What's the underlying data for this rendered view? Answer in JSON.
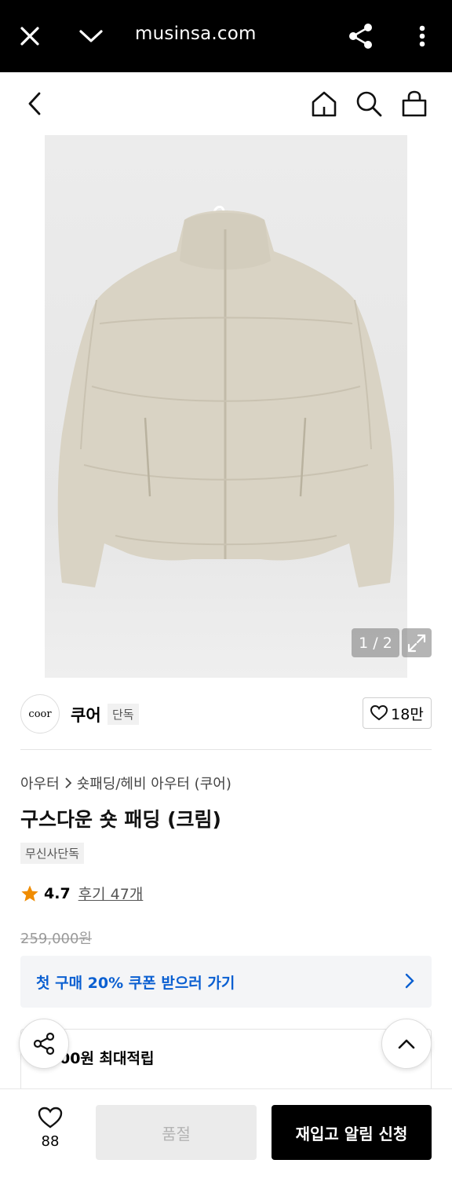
{
  "browser": {
    "url": "musinsa.com",
    "icons": [
      "close-icon",
      "chevron-down-icon",
      "share-icon",
      "more-vertical-icon"
    ]
  },
  "header": {
    "icons": [
      "back-icon",
      "home-icon",
      "search-icon",
      "bag-icon"
    ]
  },
  "gallery": {
    "counter": "1 / 2",
    "image_alt": "beige short puffer down jacket",
    "colors": {
      "jacket": "#d9d3c4",
      "jacket_shadow": "#c9c2b1",
      "background": "#e9e9e9"
    }
  },
  "brand": {
    "logo_text": "coor",
    "name": "쿠어",
    "badge": "단독",
    "likes": "18만"
  },
  "product": {
    "breadcrumb": [
      "아우터",
      "숏패딩/헤비 아우터 (쿠어)"
    ],
    "title": "구스다운 숏 패딩 (크림)",
    "tag": "무신사단독",
    "rating": "4.7",
    "reviews": "후기 47개",
    "original_price": "259,000원",
    "coupon_text": "첫 구매 20% 쿠폰 받으러 가기",
    "points_text": "00원 최대적립"
  },
  "bottom": {
    "wishlist_count": "88",
    "soldout_label": "품절",
    "restock_label": "재입고 알림 신청"
  },
  "colors": {
    "accent_blue": "#0a5fd1",
    "star": "#f08c00",
    "black": "#000000"
  }
}
